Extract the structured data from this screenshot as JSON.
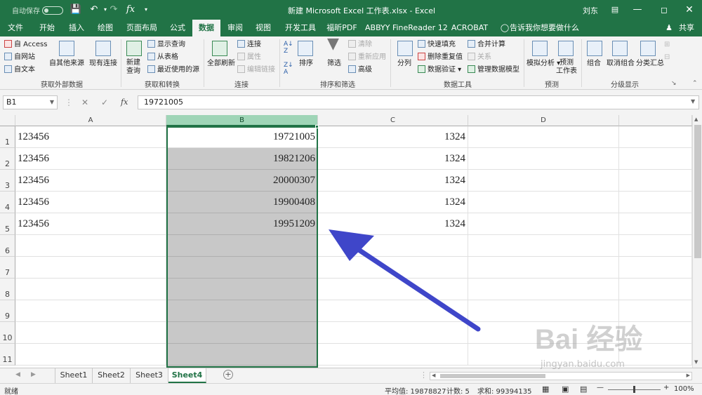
{
  "window": {
    "title": "新建 Microsoft Excel 工作表.xlsx  -  Excel",
    "autosave": "自动保存",
    "user": "刘东"
  },
  "tabs": [
    "文件",
    "开始",
    "插入",
    "绘图",
    "页面布局",
    "公式",
    "数据",
    "审阅",
    "视图",
    "开发工具",
    "福昕PDF",
    "ABBYY FineReader 12",
    "ACROBAT"
  ],
  "active_tab": "数据",
  "tellme": "告诉我你想要做什么",
  "share": "共享",
  "ribbon": {
    "get_external": {
      "access": "自 Access",
      "web": "自网站",
      "text": "自文本",
      "other": "自其他来源",
      "existing": "现有连接",
      "group": "获取外部数据"
    },
    "get_transform": {
      "new_query": "新建\n查询",
      "show_query": "显示查询",
      "from_table": "从表格",
      "recent": "最近使用的源",
      "group": "获取和转换"
    },
    "connections": {
      "refresh_all": "全部刷新",
      "connections": "连接",
      "properties": "属性",
      "edit_links": "编辑链接",
      "group": "连接"
    },
    "sort_filter": {
      "sort": "排序",
      "filter": "筛选",
      "clear": "清除",
      "reapply": "重新应用",
      "advanced": "高级",
      "group": "排序和筛选"
    },
    "data_tools": {
      "split": "分列",
      "flash_fill": "快速填充",
      "remove_dup": "删除重复值",
      "validation": "数据验证",
      "consolidate": "合并计算",
      "relations": "关系",
      "manage_model": "管理数据模型",
      "group": "数据工具"
    },
    "forecast": {
      "what_if": "模拟分析",
      "forecast_sheet": "预测\n工作表",
      "group": "预测"
    },
    "outline": {
      "group_btn": "组合",
      "ungroup": "取消组合",
      "subtotal": "分类汇总",
      "group": "分级显示"
    }
  },
  "formula_bar": {
    "name_box": "B1",
    "fx": "fx",
    "value": "19721005"
  },
  "columns": [
    "A",
    "B",
    "C",
    "D"
  ],
  "rows": [
    "1",
    "2",
    "3",
    "4",
    "5",
    "6",
    "7",
    "8",
    "9",
    "10",
    "11"
  ],
  "cells": [
    {
      "A": "123456",
      "B": "19721005",
      "C": "1324"
    },
    {
      "A": "123456",
      "B": "19821206",
      "C": "1324"
    },
    {
      "A": "123456",
      "B": "20000307",
      "C": "1324"
    },
    {
      "A": "123456",
      "B": "19900408",
      "C": "1324"
    },
    {
      "A": "123456",
      "B": "19951209",
      "C": "1324"
    }
  ],
  "sheets": [
    "Sheet1",
    "Sheet2",
    "Sheet3",
    "Sheet4"
  ],
  "active_sheet": "Sheet4",
  "status": {
    "ready": "就绪",
    "average": "平均值: 19878827",
    "count": "计数: 5",
    "sum": "求和: 99394135",
    "zoom": "100%"
  },
  "watermark": {
    "main": "Bai 经验",
    "sub": "jingyan.baidu.com"
  },
  "colors": {
    "excel_green": "#217346",
    "selection_fill": "#c8c8c8",
    "arrow": "#3f46c9"
  }
}
